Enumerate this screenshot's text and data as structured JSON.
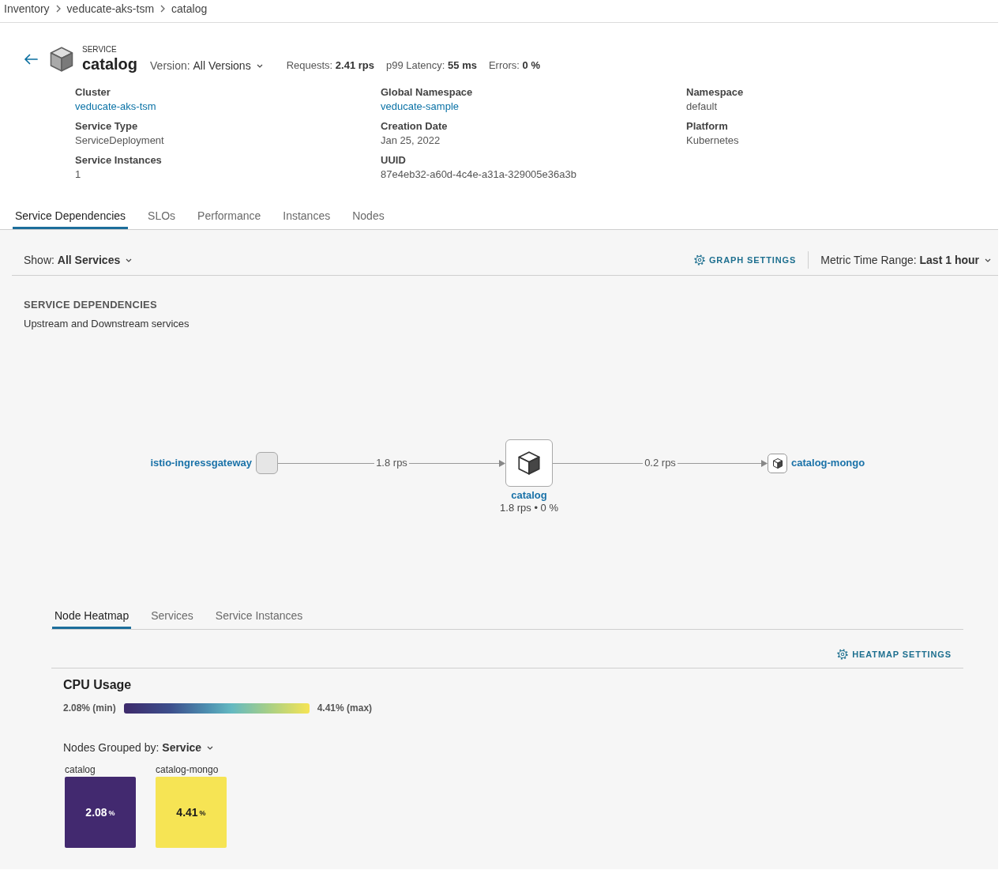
{
  "breadcrumb": [
    {
      "label": "Inventory"
    },
    {
      "label": "veducate-aks-tsm"
    },
    {
      "label": "catalog"
    }
  ],
  "header": {
    "kind_label": "SERVICE",
    "name": "catalog",
    "version": {
      "label": "Version:",
      "value": "All Versions"
    },
    "stats": [
      {
        "label": "Requests:",
        "value": "2.41 rps"
      },
      {
        "label": "p99 Latency:",
        "value": "55 ms"
      },
      {
        "label": "Errors:",
        "value": "0 %"
      }
    ]
  },
  "details": [
    {
      "label": "Cluster",
      "value": "veducate-aks-tsm",
      "kind": "link"
    },
    {
      "label": "Global Namespace",
      "value": "veducate-sample",
      "kind": "link"
    },
    {
      "label": "Namespace",
      "value": "default",
      "kind": "text"
    },
    {
      "label": "Service Type",
      "value": "ServiceDeployment",
      "kind": "text"
    },
    {
      "label": "Creation Date",
      "value": "Jan 25, 2022",
      "kind": "text"
    },
    {
      "label": "Platform",
      "value": "Kubernetes",
      "kind": "text"
    },
    {
      "label": "Service Instances",
      "value": "1",
      "kind": "text"
    },
    {
      "label": "UUID",
      "value": "87e4eb32-a60d-4c4e-a31a-329005e36a3b",
      "kind": "text"
    }
  ],
  "tabs": [
    {
      "label": "Service Dependencies",
      "selected": true
    },
    {
      "label": "SLOs",
      "selected": false
    },
    {
      "label": "Performance",
      "selected": false
    },
    {
      "label": "Instances",
      "selected": false
    },
    {
      "label": "Nodes",
      "selected": false
    }
  ],
  "toolbar": {
    "show": {
      "label": "Show:",
      "value": "All Services"
    },
    "graph_settings": "GRAPH SETTINGS",
    "time_range": {
      "label": "Metric Time Range:",
      "value": "Last 1 hour"
    }
  },
  "dependencies": {
    "title": "SERVICE DEPENDENCIES",
    "subtitle": "Upstream and Downstream services",
    "nodes": [
      {
        "name": "istio-ingressgateway",
        "kind": "gateway"
      },
      {
        "name": "catalog",
        "kind": "focus",
        "metrics": "1.8 rps • 0 %"
      },
      {
        "name": "catalog-mongo",
        "kind": "service"
      }
    ],
    "edges": [
      {
        "label": "1.8 rps"
      },
      {
        "label": "0.2 rps"
      }
    ]
  },
  "heatmap": {
    "tabs": [
      {
        "label": "Node Heatmap",
        "selected": true
      },
      {
        "label": "Services",
        "selected": false
      },
      {
        "label": "Service Instances",
        "selected": false
      }
    ],
    "settings": "HEATMAP SETTINGS",
    "title": "CPU Usage",
    "scale": {
      "min": "2.08% (min)",
      "max": "4.41% (max)"
    },
    "group_by": {
      "label": "Nodes Grouped by:",
      "value": "Service"
    },
    "tiles": [
      {
        "name": "catalog",
        "value": "2.08",
        "unit": "%",
        "color": "#42296f"
      },
      {
        "name": "catalog-mongo",
        "value": "4.41",
        "unit": "%",
        "color": "#f6e454"
      }
    ]
  }
}
